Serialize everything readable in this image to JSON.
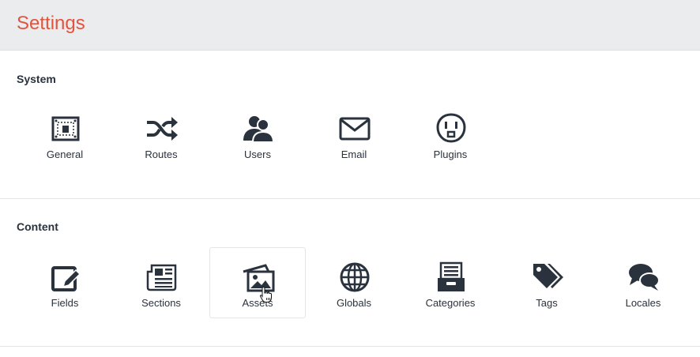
{
  "header": {
    "title": "Settings",
    "accent_color": "#e5533d"
  },
  "sections": {
    "system": {
      "title": "System",
      "items": [
        {
          "label": "General",
          "icon": "general-icon"
        },
        {
          "label": "Routes",
          "icon": "shuffle-icon"
        },
        {
          "label": "Users",
          "icon": "users-icon"
        },
        {
          "label": "Email",
          "icon": "envelope-icon"
        },
        {
          "label": "Plugins",
          "icon": "plug-icon"
        }
      ]
    },
    "content": {
      "title": "Content",
      "items": [
        {
          "label": "Fields",
          "icon": "edit-icon"
        },
        {
          "label": "Sections",
          "icon": "newspaper-icon"
        },
        {
          "label": "Assets",
          "icon": "images-icon"
        },
        {
          "label": "Globals",
          "icon": "globe-icon"
        },
        {
          "label": "Categories",
          "icon": "drawer-icon"
        },
        {
          "label": "Tags",
          "icon": "tags-icon"
        },
        {
          "label": "Locales",
          "icon": "chat-bubbles-icon"
        }
      ]
    }
  },
  "colors": {
    "text": "#29323d",
    "icon": "#29323d",
    "divider": "#e3e5e8"
  },
  "hovered_item": "Assets"
}
